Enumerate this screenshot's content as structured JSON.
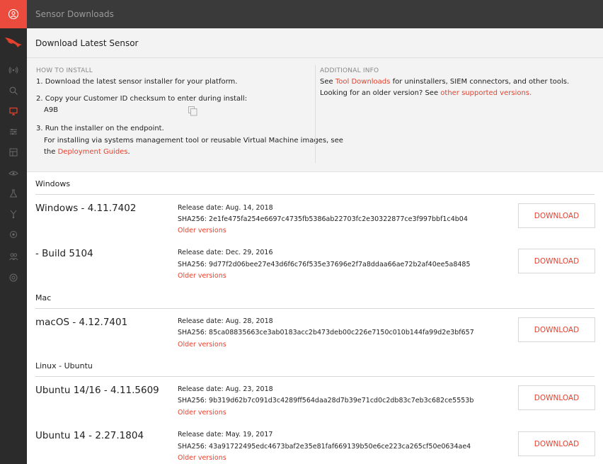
{
  "topbar": {
    "title": "Sensor Downloads"
  },
  "header": {
    "title": "Download Latest Sensor",
    "how_to_install": {
      "label": "HOW TO INSTALL",
      "step1": "1. Download the latest sensor installer for your platform.",
      "step2": "2. Copy your Customer ID checksum to enter during install:",
      "customer_id": "A9B",
      "step3": "3. Run the installer on the endpoint.",
      "step3_detail": "For installing via systems management tool or reusable Virtual Machine images, see",
      "step3_pre": "the",
      "deployment_guides_link": "Deployment Guides",
      "step3_post": "."
    },
    "additional_info": {
      "label": "ADDITIONAL INFO",
      "line1_pre": "See",
      "tool_downloads_link": "Tool Downloads",
      "line1_post": "for uninstallers, SIEM connectors, and other tools.",
      "line2_pre": "Looking for an older version? See",
      "other_versions_link": "other supported versions",
      "line2_post": "."
    }
  },
  "groups": [
    {
      "title": "Windows",
      "items": [
        {
          "name": "Windows - 4.11.7402",
          "release": "Release date: Aug. 14, 2018",
          "sha": "SHA256: 2e1fe475fa254e6697c4735fb5386ab22703fc2e30322877ce3f997bbf1c4b04",
          "older": "Older versions",
          "download": "DOWNLOAD"
        },
        {
          "name": "- Build 5104",
          "release": "Release date: Dec. 29, 2016",
          "sha": "SHA256: 9d77f2d06bee27e43d6f6c76f535e37696e2f7a8ddaa66ae72b2af40ee5a8485",
          "older": "Older versions",
          "download": "DOWNLOAD"
        }
      ]
    },
    {
      "title": "Mac",
      "items": [
        {
          "name": "macOS - 4.12.7401",
          "release": "Release date: Aug. 28, 2018",
          "sha": "SHA256: 85ca08835663ce3ab0183acc2b473deb00c226e7150c010b144fa99d2e3bf657",
          "older": "Older versions",
          "download": "DOWNLOAD"
        }
      ]
    },
    {
      "title": "Linux - Ubuntu",
      "items": [
        {
          "name": "Ubuntu 14/16 - 4.11.5609",
          "release": "Release date: Aug. 23, 2018",
          "sha": "SHA256: 9b319d62b7c091d3c4289ff564daa28d7b39e71cd0c2db83c7eb3c682ce5553b",
          "older": "Older versions",
          "download": "DOWNLOAD"
        },
        {
          "name": "Ubuntu 14 - 2.27.1804",
          "release": "Release date: May. 19, 2017",
          "sha": "SHA256: 43a91722495edc4673baf2e35e81faf669139b50e6ce223ca265cf50e0634ae4",
          "older": "Older versions",
          "download": "DOWNLOAD"
        }
      ]
    }
  ],
  "colors": {
    "accent": "#e5412d",
    "sidebar": "#2b2b2b",
    "topbar": "#3a3a3a",
    "header_bg": "#f3f3f3"
  }
}
